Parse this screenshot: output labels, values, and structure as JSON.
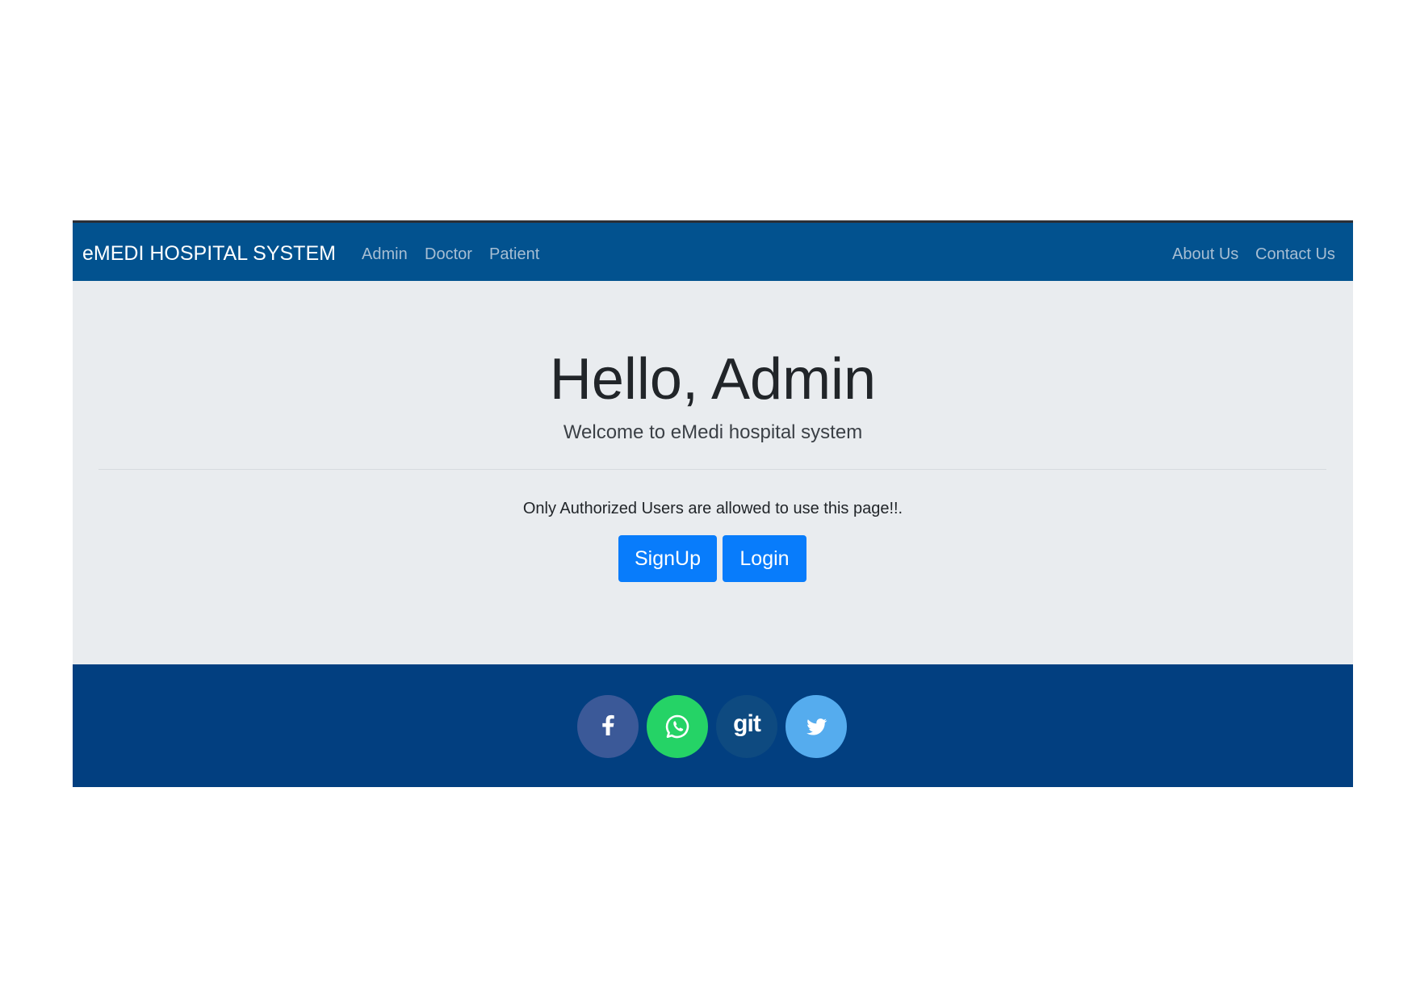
{
  "navbar": {
    "brand": "eMEDI HOSPITAL SYSTEM",
    "left_links": [
      "Admin",
      "Doctor",
      "Patient"
    ],
    "right_links": [
      "About Us",
      "Contact Us"
    ]
  },
  "hero": {
    "title": "Hello, Admin",
    "subtitle": "Welcome to eMedi hospital system",
    "notice": "Only Authorized Users are allowed to use this page!!.",
    "signup_label": "SignUp",
    "login_label": "Login"
  },
  "footer": {
    "social": [
      {
        "icon": "facebook-icon",
        "color": "#3b5998"
      },
      {
        "icon": "whatsapp-icon",
        "color": "#25d366"
      },
      {
        "icon": "git-icon",
        "label": "git",
        "color": "#0e4a80"
      },
      {
        "icon": "twitter-icon",
        "color": "#55acee"
      }
    ]
  },
  "colors": {
    "navbar_bg": "#02528f",
    "jumbotron_bg": "#e9ecef",
    "footer_bg": "#023f80",
    "primary_button": "#087cfb",
    "nav_link": "#a7bed3"
  }
}
